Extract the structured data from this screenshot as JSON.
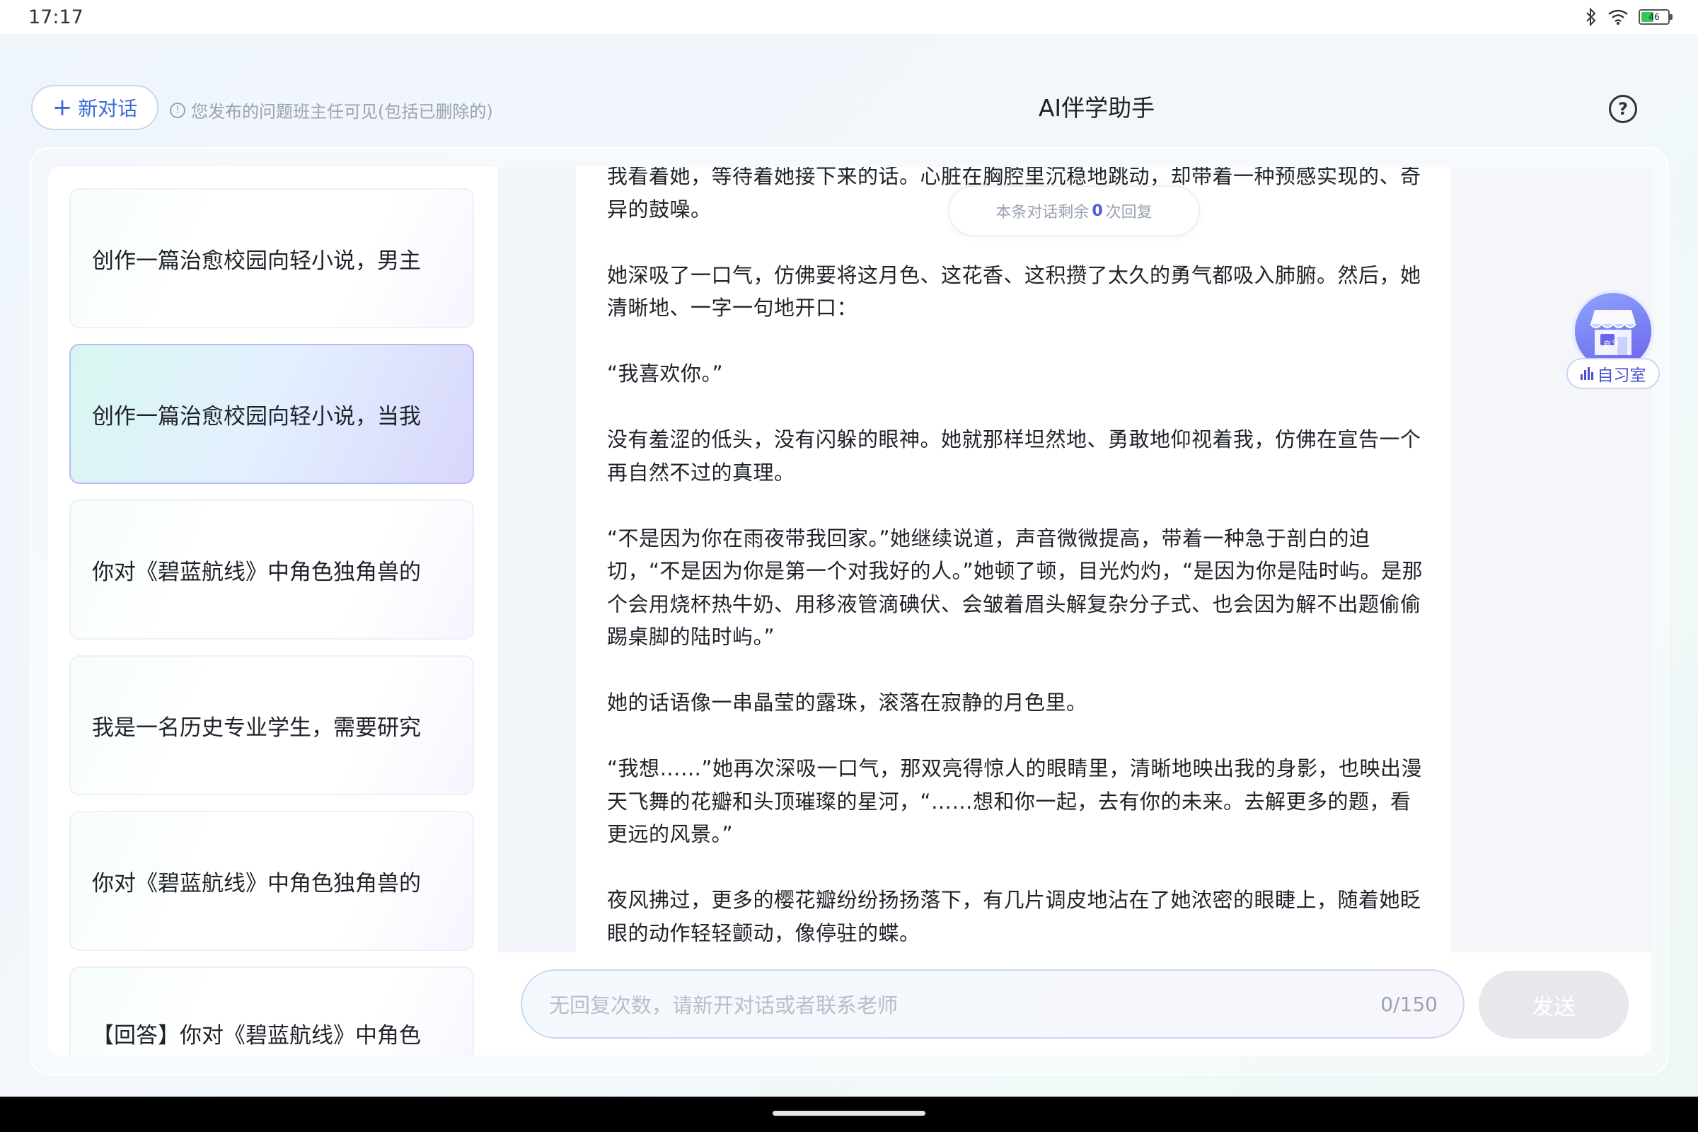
{
  "status_bar": {
    "time": "17:17",
    "battery_level": "46",
    "battery_fraction": 0.46
  },
  "header": {
    "new_chat_label": "新对话",
    "notice": "您发布的问题班主任可见(包括已删除的)",
    "title": "AI伴学助手"
  },
  "sidebar": {
    "items": [
      {
        "label": "创作一篇治愈校园向轻小说，男主",
        "active": false
      },
      {
        "label": "创作一篇治愈校园向轻小说，当我",
        "active": true
      },
      {
        "label": "你对《碧蓝航线》中角色独角兽的",
        "active": false
      },
      {
        "label": "我是一名历史专业学生，需要研究",
        "active": false
      },
      {
        "label": "你对《碧蓝航线》中角色独角兽的",
        "active": false
      },
      {
        "label": "【回答】你对《碧蓝航线》中角色",
        "active": false
      }
    ]
  },
  "remaining": {
    "prefix": "本条对话剩余",
    "count": "0",
    "suffix": "次回复"
  },
  "message": {
    "paragraphs": [
      "我看着她，等待着她接下来的话。心脏在胸腔里沉稳地跳动，却带着一种预感实现的、奇异的鼓噪。",
      "她深吸了一口气，仿佛要将这月色、这花香、这积攒了太久的勇气都吸入肺腑。然后，她清晰地、一字一句地开口：",
      "“我喜欢你。”",
      "没有羞涩的低头，没有闪躲的眼神。她就那样坦然地、勇敢地仰视着我，仿佛在宣告一个再自然不过的真理。",
      "“不是因为你在雨夜带我回家。”她继续说道，声音微微提高，带着一种急于剖白的迫切，“不是因为你是第一个对我好的人。”她顿了顿，目光灼灼，“是因为你是陆时屿。是那个会用烧杯热牛奶、用移液管滴碘伏、会皱着眉头解复杂分子式、也会因为解不出题偷偷踢桌脚的陆时屿。”",
      "她的话语像一串晶莹的露珠，滚落在寂静的月色里。",
      "“我想……”她再次深吸一口气，那双亮得惊人的眼睛里，清晰地映出我的身影，也映出漫天飞舞的花瓣和头顶璀璨的星河，“……想和你一起，去有你的未来。去解更多的题，看更远的风景。”",
      "夜风拂过，更多的樱花瓣纷纷扬扬落下，有几片调皮地沾在了她浓密的眼睫上，随着她眨眼的动作轻轻颤动，像停驻的蝶。"
    ]
  },
  "side_widget": {
    "badge": "自习",
    "label": "自习室"
  },
  "input": {
    "placeholder": "无回复次数，请新开对话或者联系老师",
    "char_count": "0/150",
    "send_label": "发送"
  },
  "colors": {
    "accent": "#3b6ad8",
    "active_card": "#d8d6fb",
    "widget": "#6a63e8"
  }
}
